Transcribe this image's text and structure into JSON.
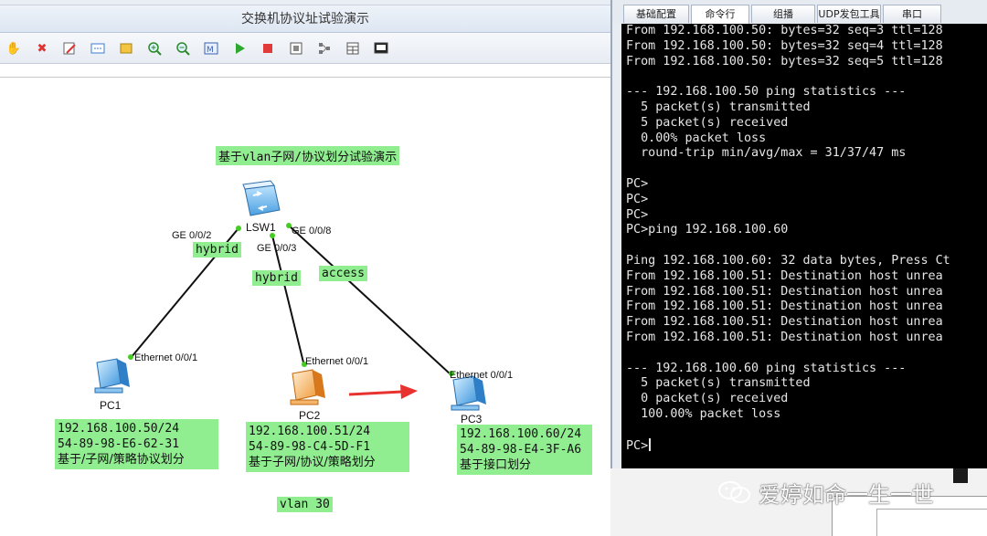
{
  "window": {
    "title": "交换机协议址试验演示"
  },
  "toolbar": {
    "buttons": [
      "hand-icon",
      "delete-icon",
      "clear-icon",
      "text-icon",
      "rect-icon",
      "zoom-in-icon",
      "zoom-out-icon",
      "fit-icon",
      "start-icon",
      "stop-icon",
      "capture-icon",
      "topology-icon",
      "grid-icon",
      "screen-icon"
    ]
  },
  "topology": {
    "heading": "基于vlan子网/协议划分试验演示",
    "switch": {
      "name": "LSW1"
    },
    "ports": {
      "sw_pc1": "GE 0/0/2",
      "sw_pc2": "GE 0/0/3",
      "sw_pc3": "GE 0/0/8",
      "pc1": "Ethernet 0/0/1",
      "pc2": "Ethernet 0/0/1",
      "pc3": "Ethernet 0/0/1"
    },
    "link_modes": {
      "pc1": "hybrid",
      "pc2": "hybrid",
      "pc3": "access"
    },
    "pcs": [
      {
        "name": "PC1",
        "ip": "192.168.100.50/24",
        "mac": "54-89-98-E6-62-31",
        "desc": "基于/子网/策略协议划分"
      },
      {
        "name": "PC2",
        "ip": "192.168.100.51/24",
        "mac": "54-89-98-C4-5D-F1",
        "desc": "基于子网/协议/策略划分"
      },
      {
        "name": "PC3",
        "ip": "192.168.100.60/24",
        "mac": "54-89-98-E4-3F-A6",
        "desc": "基于接口划分"
      }
    ],
    "vlan_label": "vlan 30",
    "colors": {
      "label_bg": "#90ee90",
      "arrow": "#e8322f",
      "link": "#111111",
      "port_dot": "#44cc22"
    }
  },
  "terminal": {
    "tabs": [
      "基础配置",
      "命令行",
      "组播",
      "UDP发包工具",
      "串口"
    ],
    "active_tab": "命令行",
    "lines": [
      "From 192.168.100.50: bytes=32 seq=3 ttl=128",
      "From 192.168.100.50: bytes=32 seq=4 ttl=128",
      "From 192.168.100.50: bytes=32 seq=5 ttl=128",
      "",
      "--- 192.168.100.50 ping statistics ---",
      "  5 packet(s) transmitted",
      "  5 packet(s) received",
      "  0.00% packet loss",
      "  round-trip min/avg/max = 31/37/47 ms",
      "",
      "PC>",
      "PC>",
      "PC>",
      "PC>ping 192.168.100.60",
      "",
      "Ping 192.168.100.60: 32 data bytes, Press Ct",
      "From 192.168.100.51: Destination host unrea",
      "From 192.168.100.51: Destination host unrea",
      "From 192.168.100.51: Destination host unrea",
      "From 192.168.100.51: Destination host unrea",
      "From 192.168.100.51: Destination host unrea",
      "",
      "--- 192.168.100.60 ping statistics ---",
      "  5 packet(s) transmitted",
      "  0 packet(s) received",
      "  100.00% packet loss"
    ],
    "prompt": "PC>"
  },
  "watermark": {
    "text": "爱婷如命一生一世"
  }
}
